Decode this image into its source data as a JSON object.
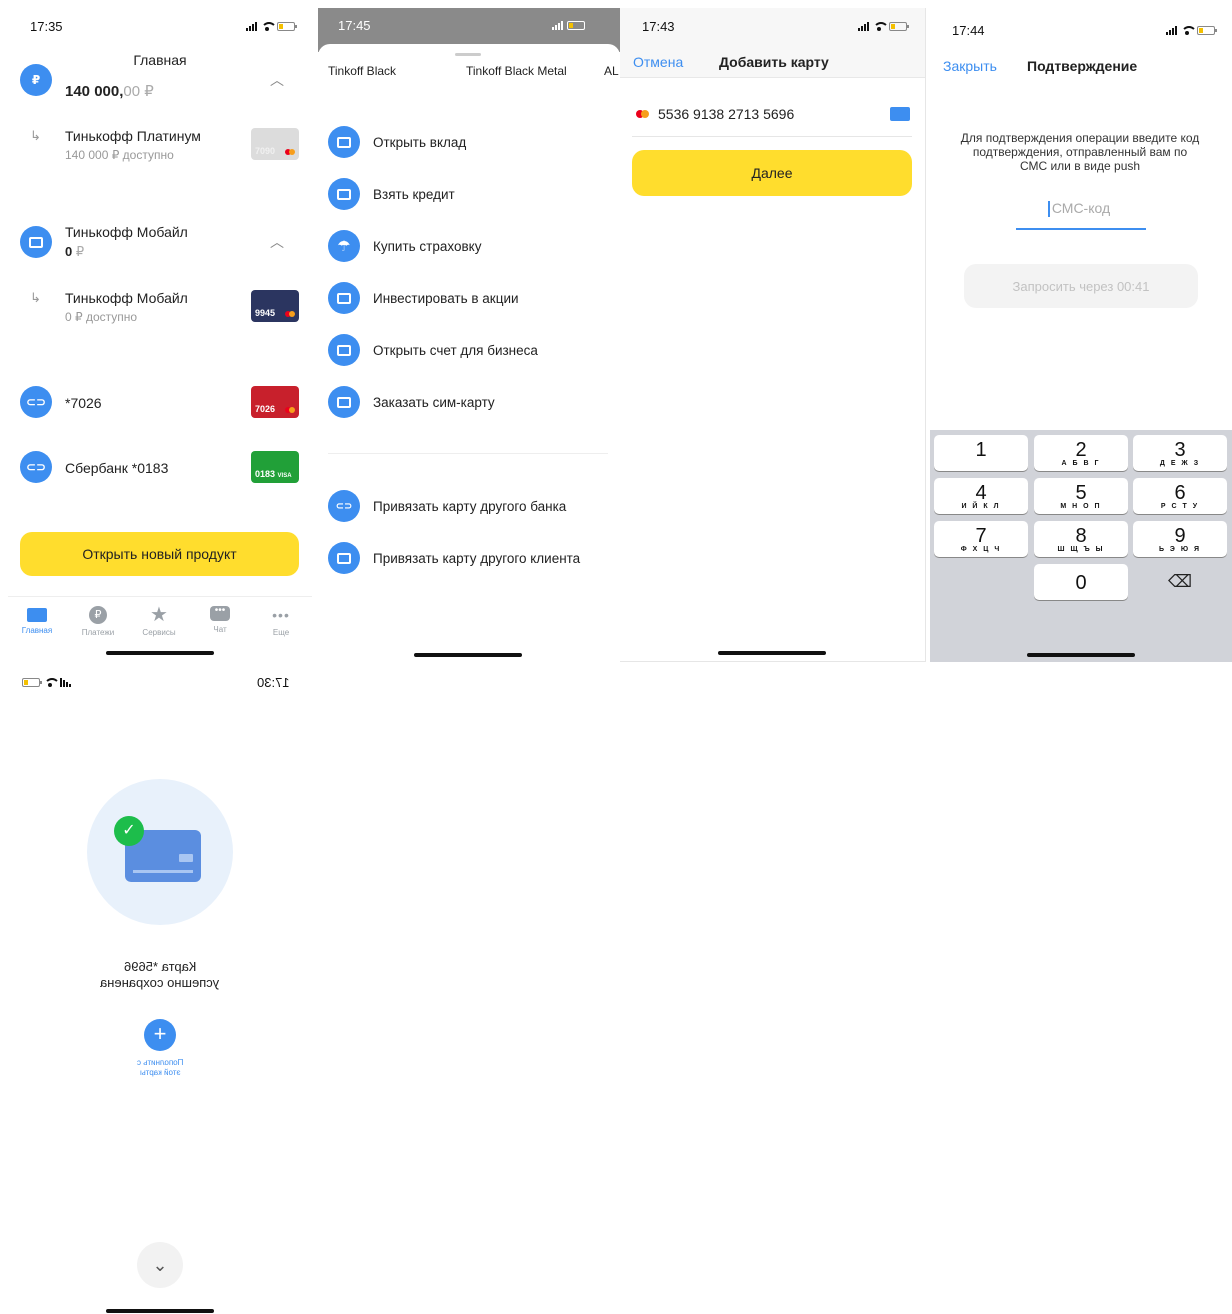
{
  "screen1": {
    "time": "17:35",
    "title": "Главная",
    "top_amount_main": "140 000,",
    "top_amount_cents": "00 ₽",
    "acc1": {
      "name": "Тинькофф Платинум",
      "available": "140 000 ₽ доступно",
      "card_num": "7090"
    },
    "acc2": {
      "name": "Тинькофф Мобайл",
      "amount": "0",
      "currency": "₽"
    },
    "acc2_sub": {
      "name": "Тинькофф Мобайл",
      "available": "0 ₽ доступно",
      "card_num": "9945"
    },
    "acc3": {
      "name": "*7026",
      "card_num": "7026"
    },
    "acc4": {
      "name": "Сбербанк *0183",
      "card_num": "0183",
      "card_brand": "VISA"
    },
    "open_button": "Открыть новый продукт",
    "tabs": [
      {
        "label": "Главная"
      },
      {
        "label": "Платежи"
      },
      {
        "label": "Сервисы"
      },
      {
        "label": "Чат"
      },
      {
        "label": "Еще"
      }
    ],
    "sub_arrow": "↳",
    "ruble_icon": "₽"
  },
  "screen2": {
    "time": "17:45",
    "tabs": [
      "Tinkoff Black",
      "Tinkoff Black Metal",
      "AL"
    ],
    "items": [
      "Открыть вклад",
      "Взять кредит",
      "Купить страховку",
      "Инвестировать в акции",
      "Открыть счет для бизнеса",
      "Заказать сим-карту"
    ],
    "items2": [
      "Привязать карту другого банка",
      "Привязать карту другого клиента"
    ]
  },
  "screen3": {
    "time": "17:43",
    "cancel": "Отмена",
    "title": "Добавить карту",
    "card_number": "5536 9138 2713 5696",
    "next_button": "Далее"
  },
  "screen4": {
    "time": "17:44",
    "close": "Закрыть",
    "title": "Подтверждение",
    "instruction": "Для подтверждения операции введите код подтверждения, отправленный вам по СМС или в виде push",
    "placeholder": "СМС-код",
    "resend": "Запросить через 00:41",
    "keys": [
      {
        "n": "1",
        "l": ""
      },
      {
        "n": "2",
        "l": "А Б В Г"
      },
      {
        "n": "3",
        "l": "Д Е Ж З"
      },
      {
        "n": "4",
        "l": "И Й К Л"
      },
      {
        "n": "5",
        "l": "М Н О П"
      },
      {
        "n": "6",
        "l": "Р С Т У"
      },
      {
        "n": "7",
        "l": "Ф Х Ц Ч"
      },
      {
        "n": "8",
        "l": "Ш Щ Ъ Ы"
      },
      {
        "n": "9",
        "l": "Ь Э Ю Я"
      },
      {
        "n": "0",
        "l": ""
      }
    ],
    "delete_icon": "⌫"
  },
  "screen5": {
    "time": "17:30",
    "line1": "Карта *5696",
    "line2": "успешно сохранена",
    "topup_line1": "Пополнить с",
    "topup_line2": "этой карты"
  },
  "colors": {
    "accent": "#3d8ef0",
    "yellow": "#ffdd2d",
    "success": "#1dbd4b"
  }
}
